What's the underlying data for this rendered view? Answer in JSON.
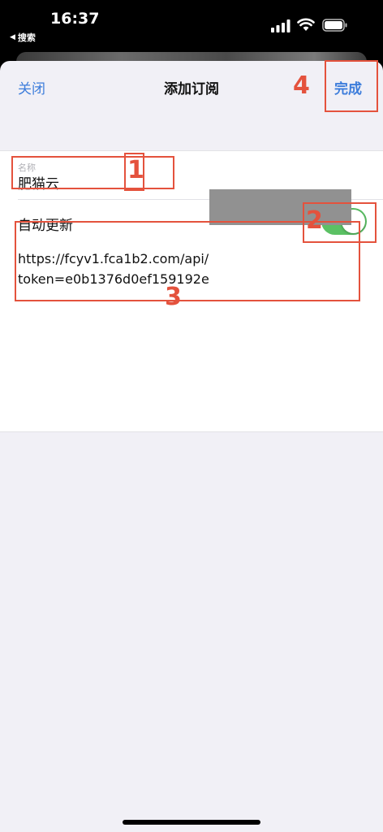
{
  "status_bar": {
    "time": "16:37",
    "back_label": "搜索",
    "back_arrow": "◀"
  },
  "nav": {
    "close_label": "关闭",
    "title": "添加订阅",
    "done_label": "完成"
  },
  "form": {
    "name_caption": "名称",
    "name_value": "肥猫云",
    "auto_update_label": "自动更新",
    "auto_update_on": true,
    "url_line1": "https://fcyv1.fca1b2.com/api/",
    "url_line2": "token=e0b1376d0ef159192e"
  },
  "annotations": [
    "1",
    "2",
    "3",
    "4"
  ],
  "colors": {
    "accent": "#3d7ddb",
    "toggle_on": "#5bc164",
    "annotation": "#e4523d",
    "sheet_bg": "#f1f0f6"
  }
}
